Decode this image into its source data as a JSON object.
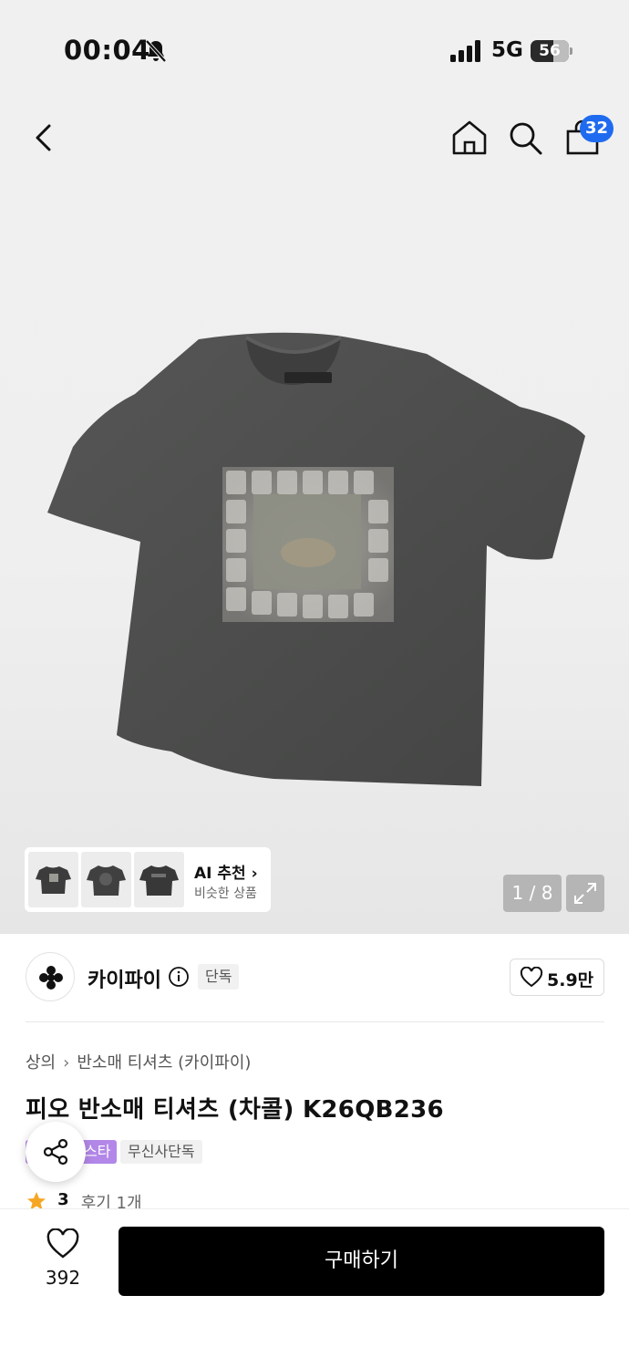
{
  "status_bar": {
    "time": "00:04",
    "network": "5G",
    "battery": "56",
    "bell_icon": "bell-slash-icon",
    "signal_icon": "signal-bars-icon"
  },
  "header": {
    "back_icon": "chevron-left-icon",
    "home_icon": "home-icon",
    "search_icon": "search-icon",
    "cart_icon": "shopping-bag-icon",
    "cart_count": "32"
  },
  "gallery": {
    "ai_recommend": {
      "title": "AI 추천",
      "subtitle": "비슷한 상품",
      "chevron_icon": "chevron-right-icon"
    },
    "pager": "1 / 8",
    "expand_icon": "expand-icon",
    "shirt_color": "#4d4e4d"
  },
  "brand": {
    "name": "카이파이",
    "info_icon": "info-icon",
    "tag": "단독",
    "likes": "5.9만",
    "heart_icon": "heart-icon",
    "logo_icon": "clover-logo-icon"
  },
  "breadcrumb": [
    "상의",
    "반소매 티셔츠 (카이파이)"
  ],
  "product": {
    "title": "피오 반소매 티셔츠 (차콜) K26QB236",
    "tags": [
      "스타",
      "무신사단독"
    ],
    "share_icon": "share-icon",
    "rating": "3",
    "reviews": "후기 1개",
    "star_icon": "star-icon"
  },
  "bottom": {
    "wish_count": "392",
    "buy_label": "구매하기"
  },
  "colors": {
    "accent_blue": "#1f6bf0",
    "tag_purple": "#b387e8",
    "star_orange": "#f5a623"
  }
}
